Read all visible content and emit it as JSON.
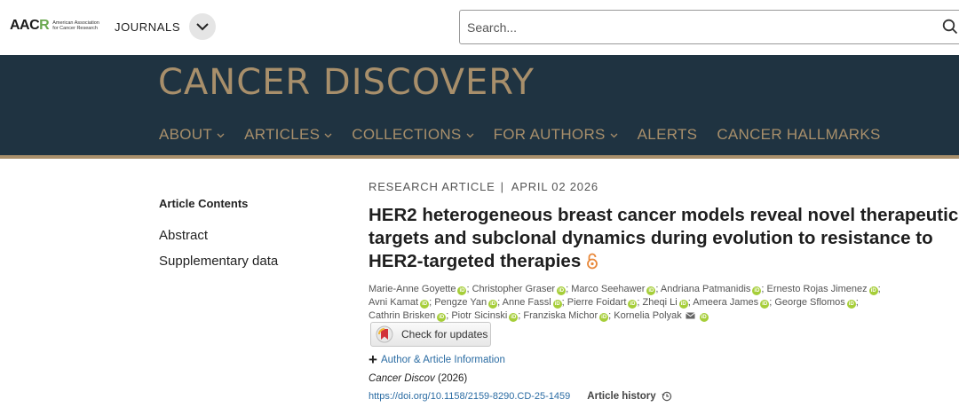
{
  "brand": {
    "logo_mark": "AAC",
    "logo_mark_accent": "R",
    "logo_subtext": "American Association for Cancer Research",
    "journals_label": "JOURNALS"
  },
  "search": {
    "placeholder": "Search..."
  },
  "journal": {
    "title": "CANCER DISCOVERY"
  },
  "nav": {
    "items": [
      {
        "label": "ABOUT",
        "has_dropdown": true
      },
      {
        "label": "ARTICLES",
        "has_dropdown": true
      },
      {
        "label": "COLLECTIONS",
        "has_dropdown": true
      },
      {
        "label": "FOR AUTHORS",
        "has_dropdown": true
      },
      {
        "label": "ALERTS",
        "has_dropdown": false
      },
      {
        "label": "CANCER HALLMARKS",
        "has_dropdown": false
      }
    ]
  },
  "sidebar": {
    "heading": "Article Contents",
    "links": [
      "Abstract",
      "Supplementary data"
    ]
  },
  "article": {
    "type": "RESEARCH ARTICLE",
    "separator": "|",
    "date": "APRIL 02 2026",
    "title": "HER2 heterogeneous breast cancer models reveal novel therapeutic targets and subclonal dynamics during evolution to resistance to HER2-targeted therapies",
    "authors": [
      "Marie-Anne Goyette",
      "Christopher Graser",
      "Marco Seehawer",
      "Andriana Patmanidis",
      "Ernesto Rojas Jimenez",
      "Avni Kamat",
      "Pengze Yan",
      "Anne Fassl",
      "Pierre Foidart",
      "Zheqi Li",
      "Ameera James",
      "George Sflomos",
      "Cathrin Brisken",
      "Piotr Sicinski",
      "Franziska Michor",
      "Kornelia Polyak"
    ],
    "corresponding_author_index": 15,
    "check_updates_label": "Check for updates",
    "author_info_label": "Author & Article Information",
    "citation_journal": "Cancer Discov",
    "citation_year": "(2026)",
    "doi": "https://doi.org/10.1158/2159-8290.CD-25-1459",
    "history_label": "Article history"
  },
  "colors": {
    "masthead_bg": "#1f3341",
    "gold": "#a88f6b",
    "link_blue": "#2b6ca3",
    "orcid_green": "#a6ce39",
    "open_access_orange": "#e8883a"
  },
  "icons": {
    "journals_toggle": "chevron-down-icon",
    "search": "search-icon",
    "open_access": "open-access-lock-icon",
    "orcid": "orcid-icon",
    "mail": "mail-icon",
    "expand": "plus-icon",
    "history": "clock-icon",
    "check_updates": "check-for-updates-icon"
  }
}
